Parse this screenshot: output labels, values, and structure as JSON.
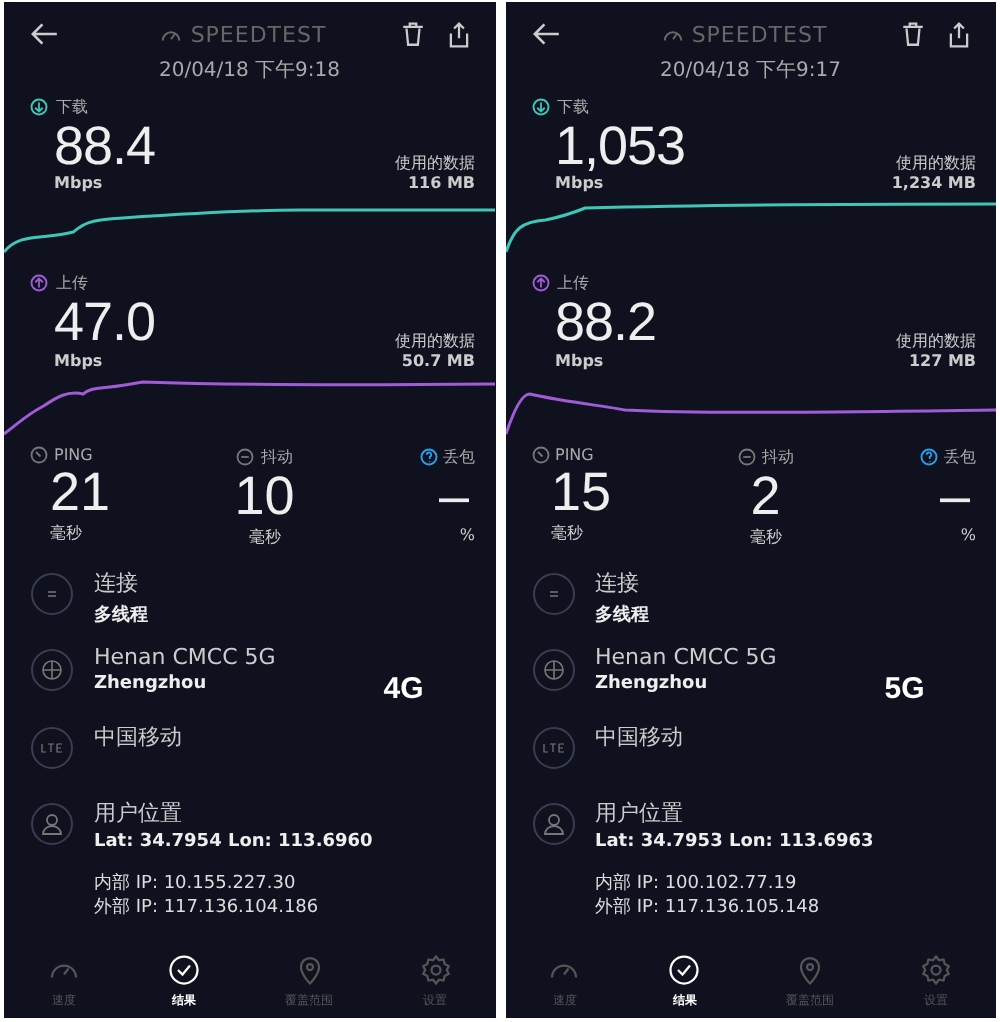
{
  "panels": [
    {
      "title": "SPEEDTEST",
      "datetime": "20/04/18 下午9:18",
      "download": {
        "label": "下载",
        "value": "88.4",
        "unit": "Mbps",
        "data_label": "使用的数据",
        "data_value": "116 MB"
      },
      "upload": {
        "label": "上传",
        "value": "47.0",
        "unit": "Mbps",
        "data_label": "使用的数据",
        "data_value": "50.7 MB"
      },
      "stats": [
        {
          "kind": "ping",
          "label": "PING",
          "value": "21",
          "unit": "毫秒"
        },
        {
          "kind": "jitter",
          "label": "抖动",
          "value": "10",
          "unit": "毫秒"
        },
        {
          "kind": "loss",
          "label": "丢包",
          "value": "–",
          "unit": "%"
        }
      ],
      "info": [
        {
          "kind": "connection",
          "title": "连接",
          "subtitle": "多线程"
        },
        {
          "kind": "server",
          "title": "Henan CMCC 5G",
          "subtitle": "Zhengzhou"
        },
        {
          "kind": "carrier",
          "title": "中国移动"
        },
        {
          "kind": "location",
          "title": "用户位置",
          "subtitle": "Lat: 34.7954 Lon: 113.6960"
        }
      ],
      "ips": [
        "内部 IP: 10.155.227.30",
        "外部 IP: 117.136.104.186"
      ],
      "tag": "4G",
      "nav": [
        {
          "kind": "speed",
          "label": "速度",
          "selected": false
        },
        {
          "kind": "results",
          "label": "结果",
          "selected": true
        },
        {
          "kind": "coverage",
          "label": "覆盖范围",
          "selected": false
        },
        {
          "kind": "settings",
          "label": "设置",
          "selected": false
        }
      ]
    },
    {
      "title": "SPEEDTEST",
      "datetime": "20/04/18 下午9:17",
      "download": {
        "label": "下载",
        "value": "1,053",
        "unit": "Mbps",
        "data_label": "使用的数据",
        "data_value": "1,234 MB"
      },
      "upload": {
        "label": "上传",
        "value": "88.2",
        "unit": "Mbps",
        "data_label": "使用的数据",
        "data_value": "127 MB"
      },
      "stats": [
        {
          "kind": "ping",
          "label": "PING",
          "value": "15",
          "unit": "毫秒"
        },
        {
          "kind": "jitter",
          "label": "抖动",
          "value": "2",
          "unit": "毫秒"
        },
        {
          "kind": "loss",
          "label": "丢包",
          "value": "–",
          "unit": "%"
        }
      ],
      "info": [
        {
          "kind": "connection",
          "title": "连接",
          "subtitle": "多线程"
        },
        {
          "kind": "server",
          "title": "Henan CMCC 5G",
          "subtitle": "Zhengzhou"
        },
        {
          "kind": "carrier",
          "title": "中国移动"
        },
        {
          "kind": "location",
          "title": "用户位置",
          "subtitle": "Lat: 34.7953 Lon: 113.6963"
        }
      ],
      "ips": [
        "内部 IP: 100.102.77.19",
        "外部 IP: 117.136.105.148"
      ],
      "tag": "5G",
      "nav": [
        {
          "kind": "speed",
          "label": "速度",
          "selected": false
        },
        {
          "kind": "results",
          "label": "结果",
          "selected": true
        },
        {
          "kind": "coverage",
          "label": "覆盖范围",
          "selected": false
        },
        {
          "kind": "settings",
          "label": "设置",
          "selected": false
        }
      ]
    }
  ]
}
